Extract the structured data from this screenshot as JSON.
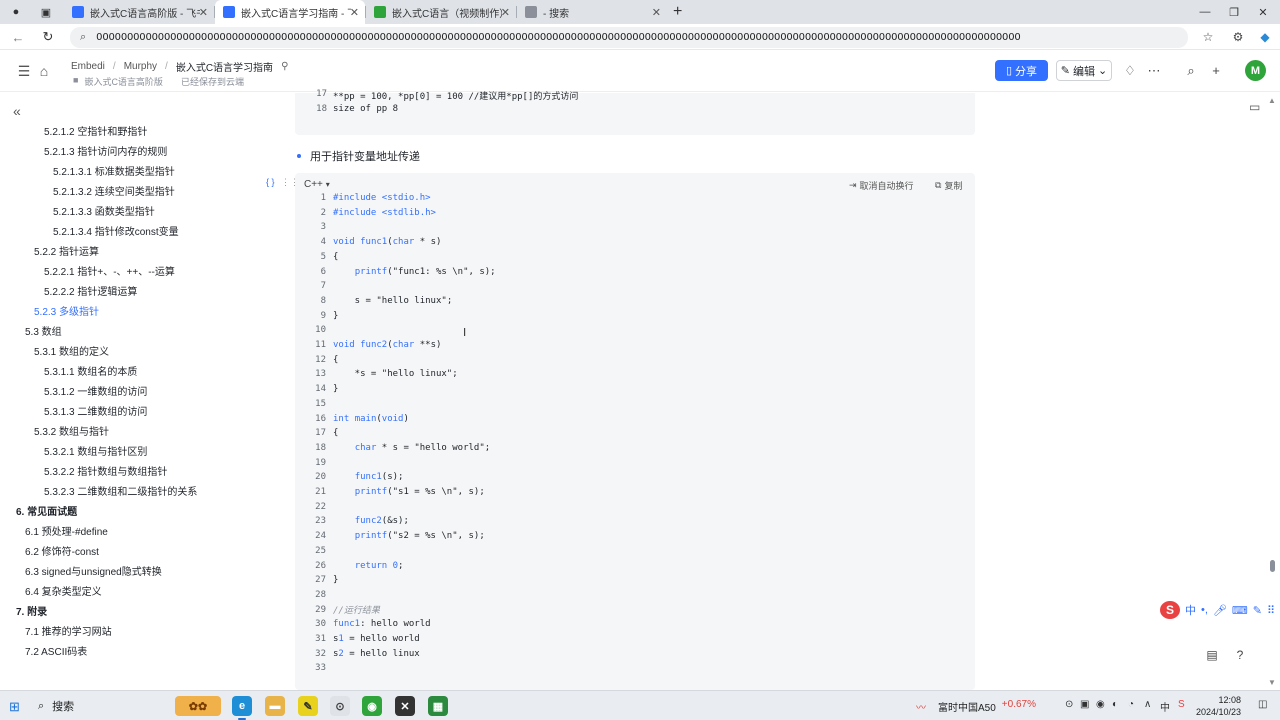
{
  "browser": {
    "tabs": [
      {
        "label": "嵌入式C语言高阶版 - 飞书云文档",
        "color": "#3370ff",
        "active": false
      },
      {
        "label": "嵌入式C语言学习指南 - 飞书云文",
        "color": "#3370ff",
        "active": true
      },
      {
        "label": "嵌入式C语言（视频制作）- 飞书",
        "color": "#2fa43a",
        "active": false
      },
      {
        "label": "- 搜索",
        "color": "#8a8f99",
        "active": false
      }
    ],
    "new_tab": "+",
    "url": "000000000000000000000000000000000000000000000000000000000000000000000000000000000000000000000000000000000000000000000000000000000000000000000000000000"
  },
  "doc_header": {
    "breadcrumbs": [
      "Embedi",
      "Murphy",
      "嵌入式C语言学习指南"
    ],
    "sub_title": "嵌入式C语言高阶版",
    "save_status": "已经保存到云端",
    "share_label": "分享",
    "edit_label": "编辑",
    "avatar_letter": "M"
  },
  "toc": [
    {
      "label": "5.2.1.2 空指针和野指针",
      "level": 3,
      "active": false
    },
    {
      "label": "5.2.1.3 指针访问内存的规则",
      "level": 3,
      "active": false
    },
    {
      "label": "5.2.1.3.1 标准数据类型指针",
      "level": 4,
      "active": false
    },
    {
      "label": "5.2.1.3.2 连续空间类型指针",
      "level": 4,
      "active": false
    },
    {
      "label": "5.2.1.3.3 函数类型指针",
      "level": 4,
      "active": false
    },
    {
      "label": "5.2.1.3.4 指针修改const变量",
      "level": 4,
      "active": false
    },
    {
      "label": "5.2.2 指针运算",
      "level": 2,
      "active": false
    },
    {
      "label": "5.2.2.1 指针+、-、++、--运算",
      "level": 3,
      "active": false
    },
    {
      "label": "5.2.2.2 指针逻辑运算",
      "level": 3,
      "active": false
    },
    {
      "label": "5.2.3 多级指针",
      "level": 2,
      "active": true
    },
    {
      "label": "5.3 数组",
      "level": 1,
      "active": false
    },
    {
      "label": "5.3.1 数组的定义",
      "level": 2,
      "active": false
    },
    {
      "label": "5.3.1.1 数组名的本质",
      "level": 3,
      "active": false
    },
    {
      "label": "5.3.1.2 一维数组的访问",
      "level": 3,
      "active": false
    },
    {
      "label": "5.3.1.3 二维数组的访问",
      "level": 3,
      "active": false
    },
    {
      "label": "5.3.2 数组与指针",
      "level": 2,
      "active": false
    },
    {
      "label": "5.3.2.1 数组与指针区别",
      "level": 3,
      "active": false
    },
    {
      "label": "5.3.2.2 指针数组与数组指针",
      "level": 3,
      "active": false
    },
    {
      "label": "5.3.2.3 二维数组和二级指针的关系",
      "level": 3,
      "active": false
    },
    {
      "label": "6. 常见面试题",
      "level": 0,
      "active": false
    },
    {
      "label": "6.1 预处理-#define",
      "level": 1,
      "active": false
    },
    {
      "label": "6.2 修饰符-const",
      "level": 1,
      "active": false
    },
    {
      "label": "6.3 signed与unsigned隐式转换",
      "level": 1,
      "active": false
    },
    {
      "label": "6.4 复杂类型定义",
      "level": 1,
      "active": false
    },
    {
      "label": "7. 附录",
      "level": 0,
      "active": false
    },
    {
      "label": "7.1 推荐的学习网站",
      "level": 1,
      "active": false
    },
    {
      "label": "7.2 ASCII码表",
      "level": 1,
      "active": false
    }
  ],
  "prev_code": [
    {
      "n": "17",
      "text": "**pp = 100, *pp[0] = 100 //建议用*pp[]的方式访问"
    },
    {
      "n": "18",
      "text": "size of pp 8"
    }
  ],
  "bullet_text": "用于指针变量地址传递",
  "code_block": {
    "language": "C++",
    "wrap_label": "取消自动换行",
    "copy_label": "复制",
    "lines": [
      {
        "n": "1",
        "text": "#include <stdio.h>"
      },
      {
        "n": "2",
        "text": "#include <stdlib.h>"
      },
      {
        "n": "3",
        "text": ""
      },
      {
        "n": "4",
        "text": "void func1(char * s)"
      },
      {
        "n": "5",
        "text": "{"
      },
      {
        "n": "6",
        "text": "    printf(\"func1: %s \\n\", s);"
      },
      {
        "n": "7",
        "text": ""
      },
      {
        "n": "8",
        "text": "    s = \"hello linux\";"
      },
      {
        "n": "9",
        "text": "}"
      },
      {
        "n": "10",
        "text": ""
      },
      {
        "n": "11",
        "text": "void func2(char **s)"
      },
      {
        "n": "12",
        "text": "{"
      },
      {
        "n": "13",
        "text": "    *s = \"hello linux\";"
      },
      {
        "n": "14",
        "text": "}"
      },
      {
        "n": "15",
        "text": ""
      },
      {
        "n": "16",
        "text": "int main(void)"
      },
      {
        "n": "17",
        "text": "{"
      },
      {
        "n": "18",
        "text": "    char * s = \"hello world\";"
      },
      {
        "n": "19",
        "text": ""
      },
      {
        "n": "20",
        "text": "    func1(s);"
      },
      {
        "n": "21",
        "text": "    printf(\"s1 = %s \\n\", s);"
      },
      {
        "n": "22",
        "text": ""
      },
      {
        "n": "23",
        "text": "    func2(&s);"
      },
      {
        "n": "24",
        "text": "    printf(\"s2 = %s \\n\", s);"
      },
      {
        "n": "25",
        "text": ""
      },
      {
        "n": "26",
        "text": "    return 0;"
      },
      {
        "n": "27",
        "text": "}"
      },
      {
        "n": "28",
        "text": ""
      },
      {
        "n": "29",
        "text": "//运行结果"
      },
      {
        "n": "30",
        "text": "func1: hello world"
      },
      {
        "n": "31",
        "text": "s1 = hello world"
      },
      {
        "n": "32",
        "text": "s2 = hello linux"
      },
      {
        "n": "33",
        "text": ""
      }
    ]
  },
  "taskbar": {
    "search_label": "搜索",
    "stock_name": "富时中国A50",
    "stock_change": "+0.67%",
    "ime_lang": "中",
    "time": "12:08",
    "date": "2024/10/23"
  },
  "colors": {
    "accent": "#3370ff",
    "avatar": "#2fa43a",
    "stock_up": "#e0403a"
  }
}
